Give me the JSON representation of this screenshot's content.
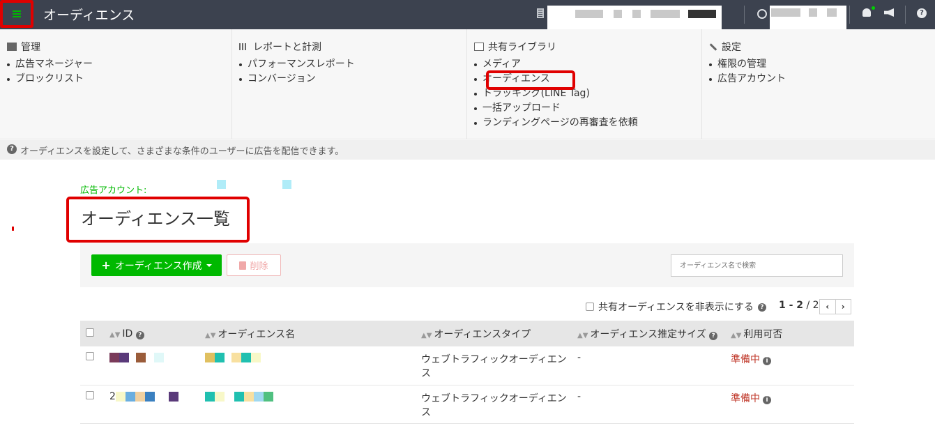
{
  "header": {
    "app_title": "オーディエンス",
    "icons": [
      "hamburger-menu-icon",
      "building-icon",
      "user-icon",
      "bell-icon",
      "megaphone-icon",
      "help-icon"
    ]
  },
  "mega_menu": {
    "columns": [
      {
        "title": "管理",
        "icon": "bank-icon",
        "items": [
          "広告マネージャー",
          "ブロックリスト"
        ]
      },
      {
        "title": "レポートと計測",
        "icon": "bar-chart-icon",
        "items": [
          "パフォーマンスレポート",
          "コンバージョン"
        ]
      },
      {
        "title": "共有ライブラリ",
        "icon": "image-icon",
        "items": [
          "メディア",
          "オーディエンス",
          "トラッキング(LINE Tag)",
          "一括アップロード",
          "ランディングページの再審査を依頼"
        ]
      },
      {
        "title": "設定",
        "icon": "wrench-icon",
        "items": [
          "権限の管理",
          "広告アカウント"
        ]
      }
    ]
  },
  "notice": "オーディエンスを設定して、さまざまな条件のユーザーに広告を配信できます。",
  "account_label": "広告アカウント:",
  "page_title": "オーディエンス一覧",
  "toolbar": {
    "create_label": "オーディエンス作成",
    "delete_label": "削除",
    "search_placeholder": "オーディエンス名で検索"
  },
  "filter": {
    "hide_shared_label": "共有オーディエンスを非表示にする",
    "pager_range": "1 - 2",
    "pager_total": "/ 2"
  },
  "table": {
    "columns": [
      "ID",
      "オーディエンス名",
      "オーディエンスタイプ",
      "オーディエンス推定サイズ",
      "利用可否"
    ],
    "rows": [
      {
        "id": "",
        "name": "",
        "type": "ウェブトラフィックオーディエンス",
        "size": "-",
        "status": "準備中"
      },
      {
        "id": "2",
        "name": "",
        "type": "ウェブトラフィックオーディエンス",
        "size": "-",
        "status": "準備中"
      }
    ]
  },
  "colors": {
    "brand_green": "#00b900",
    "topbar": "#3c424f",
    "highlight_red": "#e00000",
    "status_red": "#c0392b"
  }
}
